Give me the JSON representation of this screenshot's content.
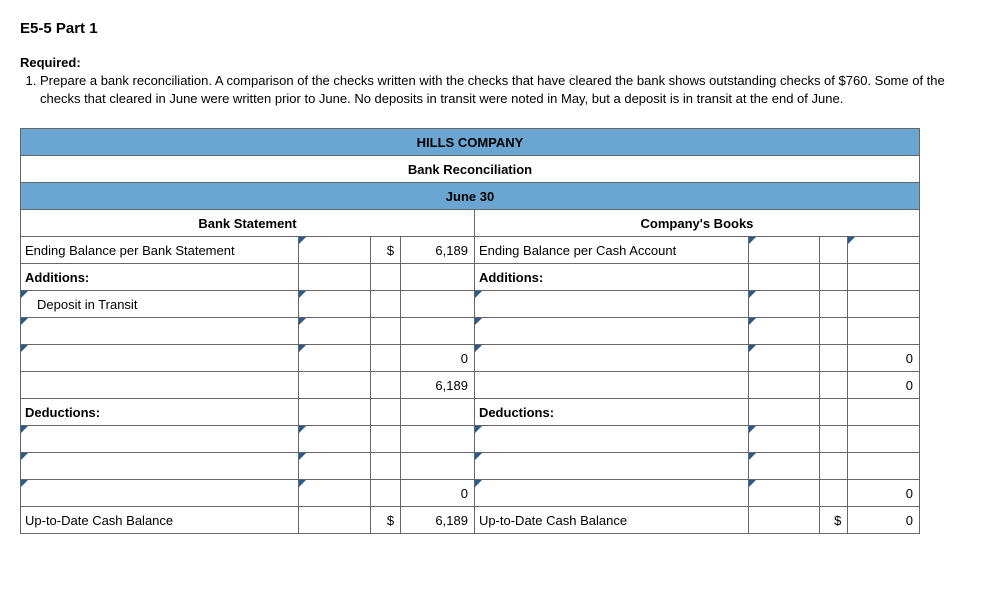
{
  "title": "E5-5 Part 1",
  "required_label": "Required:",
  "instruction_num": "1.",
  "instruction": "Prepare a bank reconciliation. A comparison of the checks written with the checks that have cleared the bank shows outstanding checks of $760. Some of the checks that cleared in June were written prior to June. No deposits in transit were noted in May, but a deposit is in transit at the end of June.",
  "header": {
    "company": "HILLS COMPANY",
    "doc": "Bank Reconciliation",
    "date": "June 30"
  },
  "columns": {
    "bank": "Bank Statement",
    "company": "Company's Books"
  },
  "rows": {
    "ending_bank": "Ending Balance per Bank Statement",
    "ending_cash": "Ending Balance per Cash Account",
    "additions": "Additions:",
    "deposit_in_transit": "Deposit in Transit",
    "deductions": "Deductions:",
    "uptodate": "Up-to-Date Cash Balance"
  },
  "vals": {
    "dollar": "$",
    "bank_ending": "6,189",
    "add_sub_bank": "0",
    "add_total_bank": "6,189",
    "ded_sub_bank": "0",
    "uptodate_bank": "6,189",
    "add_sub_co": "0",
    "add_total_co": "0",
    "ded_sub_co": "0",
    "uptodate_co": "0"
  }
}
